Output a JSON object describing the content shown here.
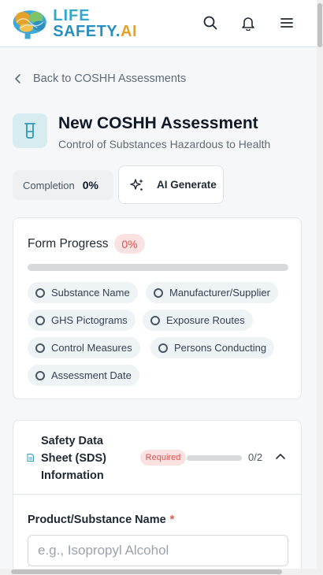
{
  "header": {
    "logo_line1": "LIFE",
    "logo_line2": "SAFETY.",
    "logo_line2_accent": "AI",
    "icons": [
      "search-icon",
      "bell-icon",
      "menu-icon"
    ]
  },
  "back_link": "Back to COSHH Assessments",
  "page": {
    "title": "New COSHH Assessment",
    "subtitle": "Control of Substances Hazardous to Health",
    "icon": "beaker-icon"
  },
  "completion": {
    "label": "Completion",
    "value": "0%",
    "fraction": 0
  },
  "ai_generate_label": "AI Generate",
  "form_progress": {
    "title": "Form Progress",
    "badge": "0%",
    "fraction": 0,
    "items": [
      {
        "label": "Substance Name"
      },
      {
        "label": "Manufacturer/Supplier"
      },
      {
        "label": "GHS Pictograms"
      },
      {
        "label": "Exposure Routes"
      },
      {
        "label": "Control Measures"
      },
      {
        "label": "Persons Conducting"
      },
      {
        "label": "Assessment Date"
      }
    ]
  },
  "sds_section": {
    "title": "Safety Data Sheet (SDS) Information",
    "badge": "Required",
    "progress_fraction": 0,
    "count": "0/2",
    "field_label": "Product/Substance Name",
    "required_mark": "*",
    "field_placeholder": "e.g., Isopropyl Alcohol",
    "field_value": ""
  },
  "colors": {
    "brand_blue": "#35a7c9",
    "brand_orange": "#e5a22b",
    "danger_bg": "#fbe2e2",
    "danger_text": "#d9534f",
    "icon_tile": "#d6ecf1"
  }
}
